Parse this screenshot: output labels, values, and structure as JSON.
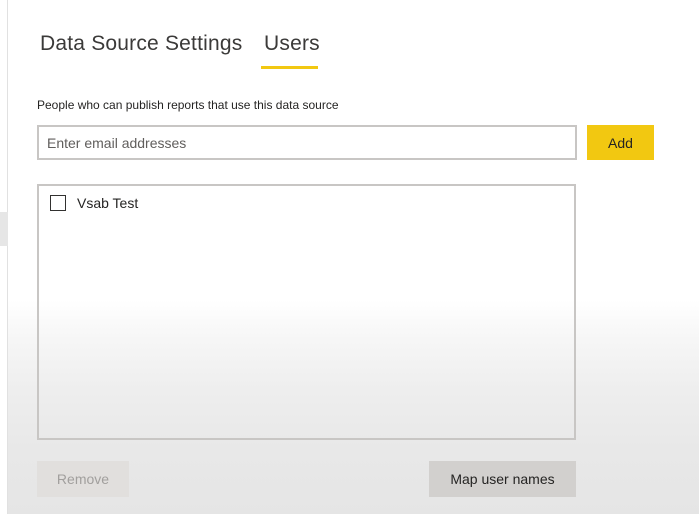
{
  "tabs": [
    {
      "label": "Data Source Settings",
      "active": false
    },
    {
      "label": "Users",
      "active": true
    }
  ],
  "description": "People who can publish reports that use this data source",
  "email_input": {
    "value": "",
    "placeholder": "Enter email addresses"
  },
  "add_label": "Add",
  "users": [
    {
      "name": "Vsab Test",
      "checked": false
    }
  ],
  "remove_label": "Remove",
  "map_label": "Map user names",
  "colors": {
    "accent": "#f2c811"
  }
}
